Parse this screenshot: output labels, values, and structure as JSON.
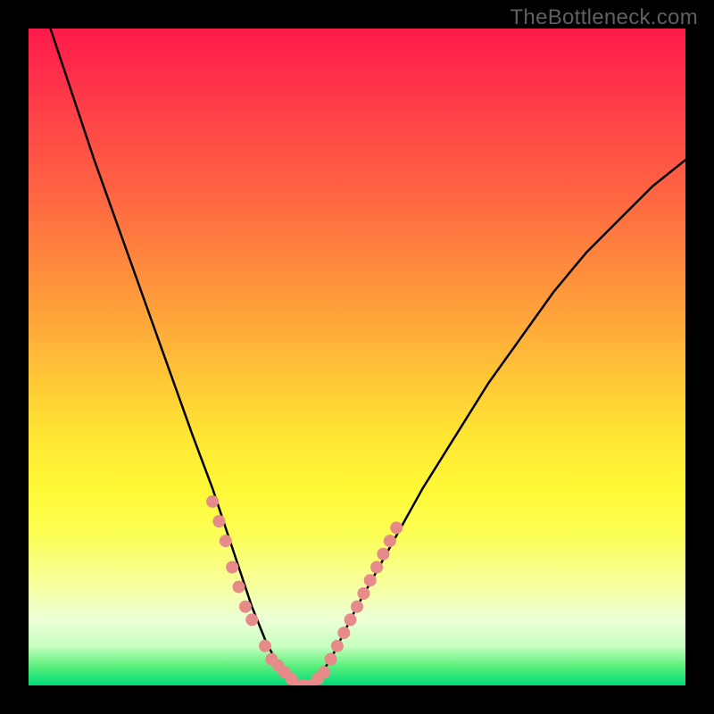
{
  "watermark": "TheBottleneck.com",
  "chart_data": {
    "type": "line",
    "title": "",
    "xlabel": "",
    "ylabel": "",
    "xlim": [
      0,
      100
    ],
    "ylim": [
      0,
      100
    ],
    "series": [
      {
        "name": "bottleneck-curve",
        "x": [
          0,
          5,
          10,
          15,
          20,
          25,
          28,
          30,
          32,
          34,
          36,
          38,
          40,
          42,
          44,
          46,
          48,
          50,
          55,
          60,
          65,
          70,
          75,
          80,
          85,
          90,
          95,
          100
        ],
        "values": [
          110,
          95,
          80,
          66,
          52,
          38,
          30,
          24,
          18,
          12,
          7,
          3,
          1,
          0,
          1,
          4,
          8,
          12,
          21,
          30,
          38,
          46,
          53,
          60,
          66,
          71,
          76,
          80
        ]
      }
    ],
    "dot_cluster": {
      "name": "highlight-dots",
      "color": "#e68a8a",
      "x": [
        28,
        29,
        30,
        31,
        32,
        33,
        34,
        36,
        37,
        38,
        39,
        40,
        41,
        42,
        43,
        44,
        45,
        46,
        47,
        48,
        49,
        50,
        51,
        52,
        53,
        54,
        55,
        56
      ],
      "values": [
        28,
        25,
        22,
        18,
        15,
        12,
        10,
        6,
        4,
        3,
        2,
        1,
        0,
        0,
        0,
        1,
        2,
        4,
        6,
        8,
        10,
        12,
        14,
        16,
        18,
        20,
        22,
        24
      ]
    },
    "gradient_stops": [
      {
        "pos": 0.0,
        "color": "#ff1a4a"
      },
      {
        "pos": 0.35,
        "color": "#ff833e"
      },
      {
        "pos": 0.62,
        "color": "#ffe634"
      },
      {
        "pos": 0.85,
        "color": "#f6ffa1"
      },
      {
        "pos": 1.0,
        "color": "#00d976"
      }
    ]
  }
}
